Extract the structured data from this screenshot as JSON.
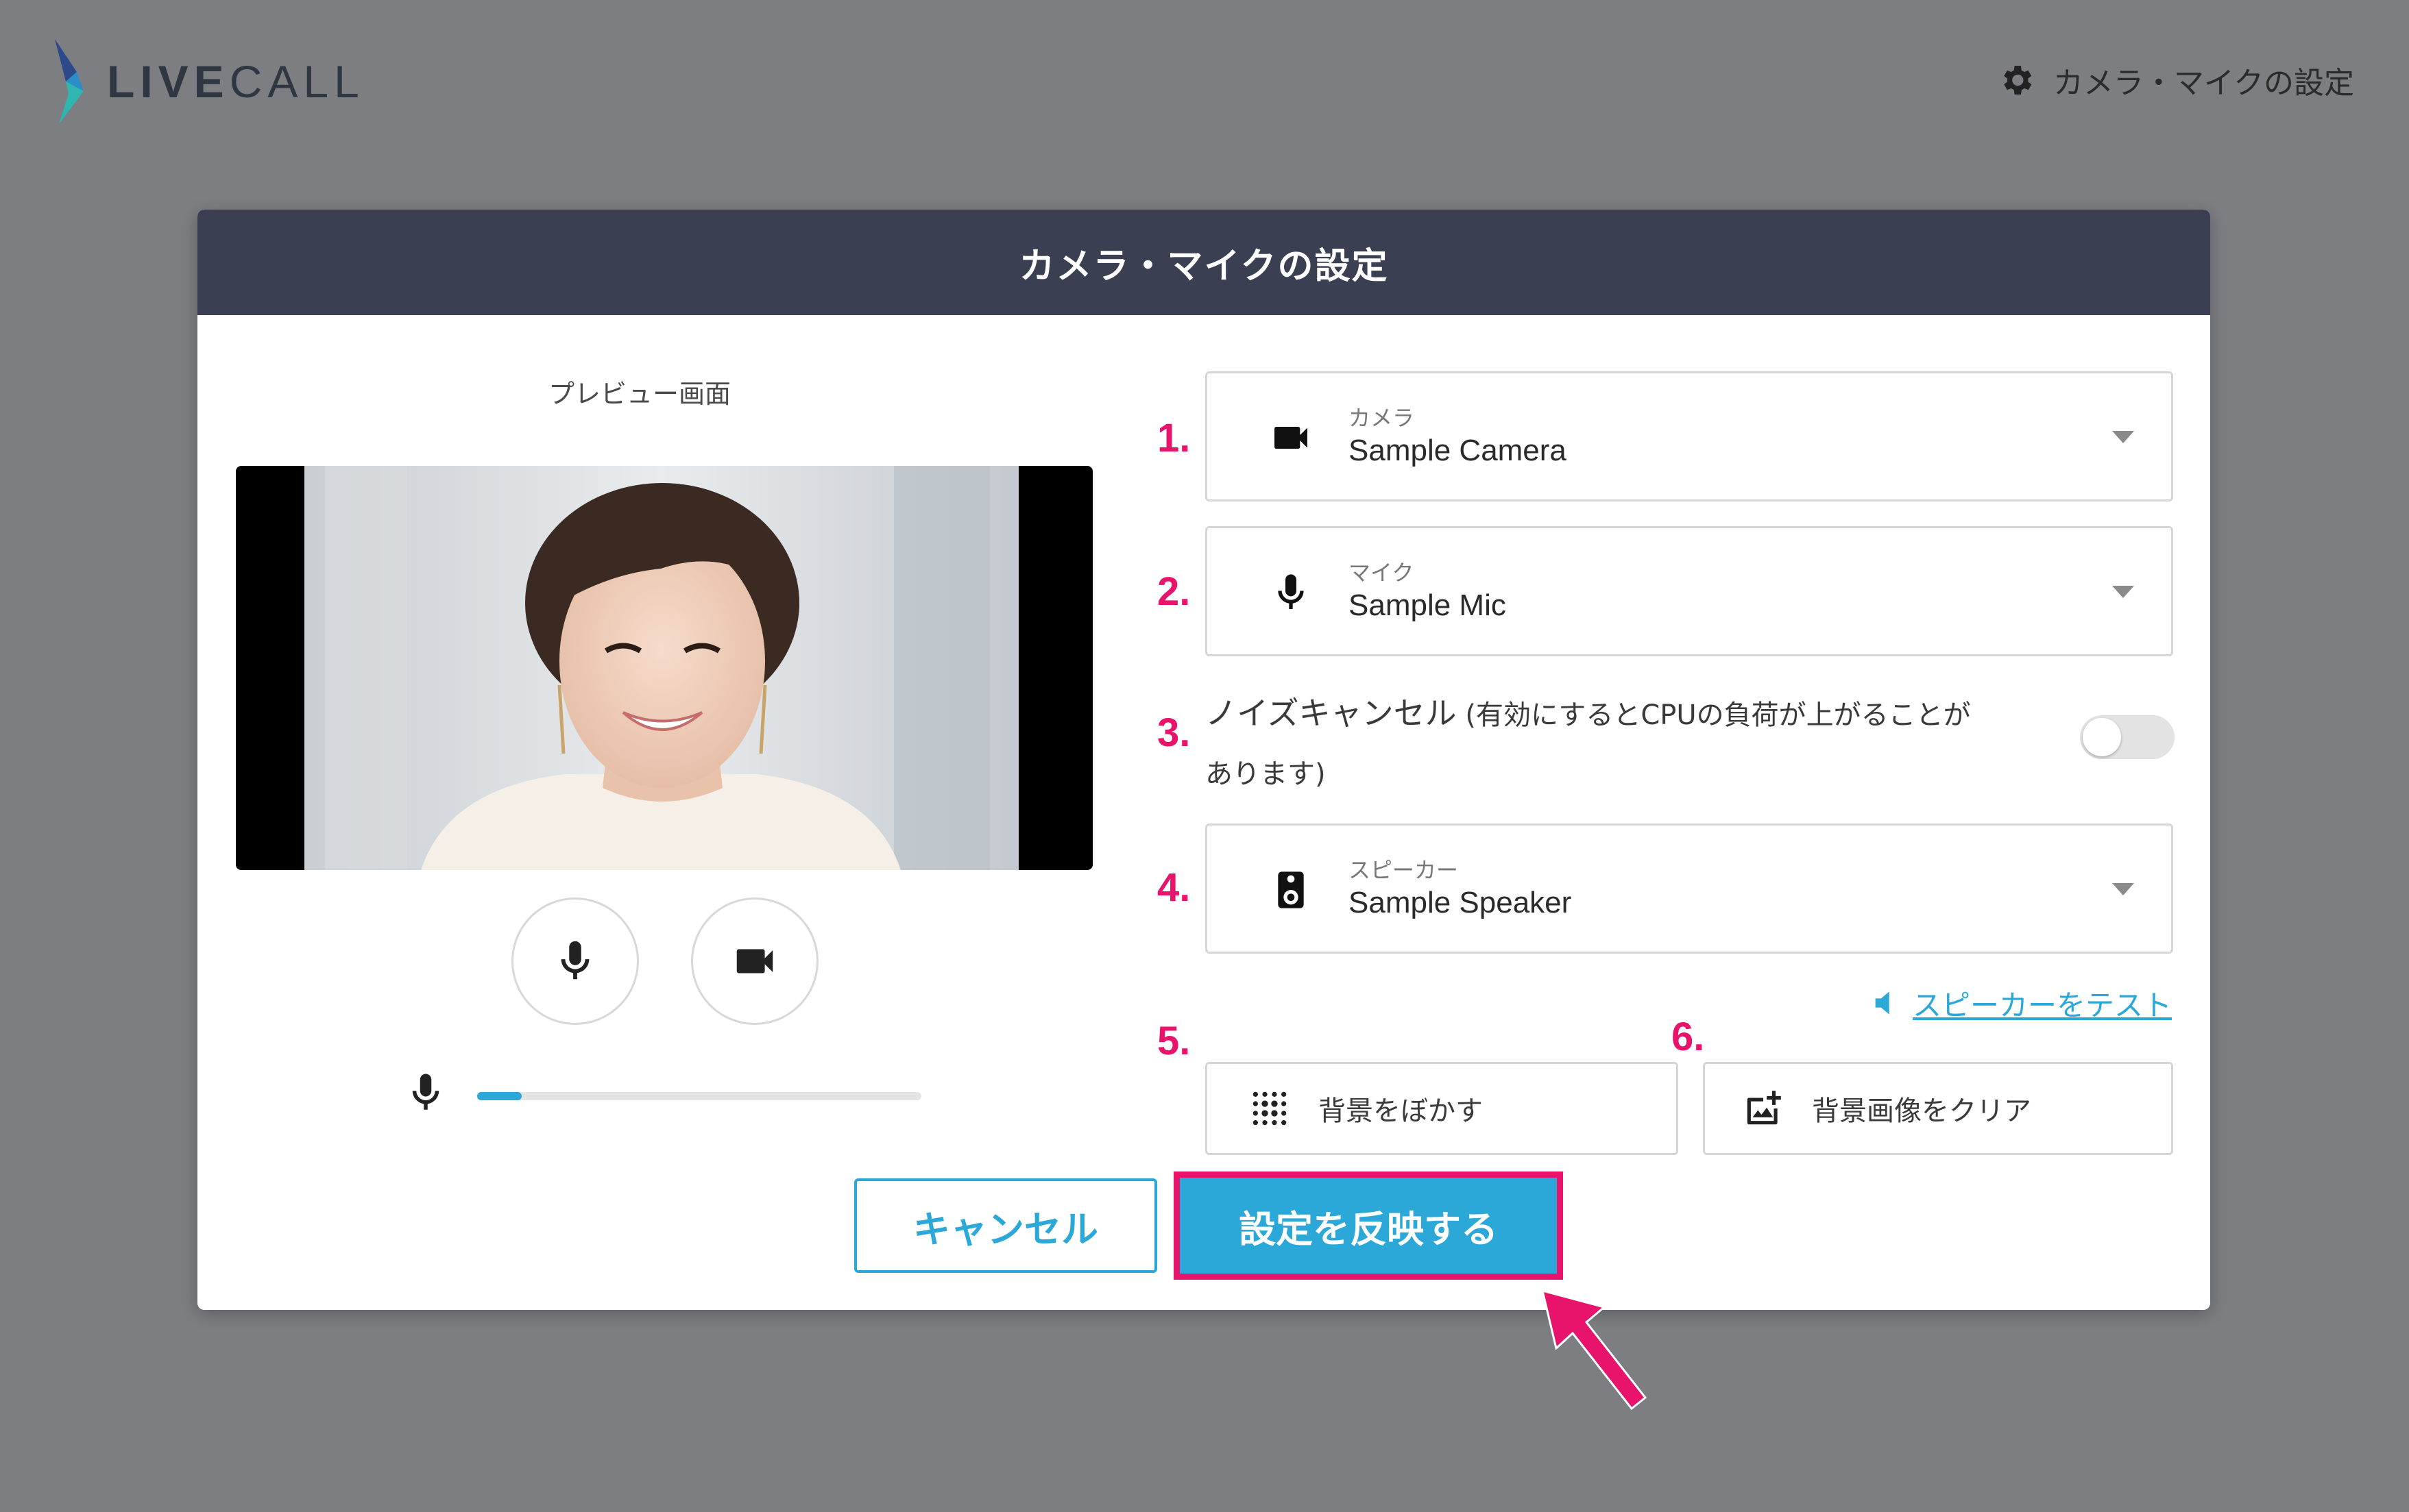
{
  "header": {
    "logo_text_bold": "LIVE",
    "logo_text_light": "CALL",
    "settings_label": "カメラ・マイクの設定",
    "settings_icon": "gear-icon"
  },
  "modal": {
    "title": "カメラ・マイクの設定",
    "preview_label": "プレビュー画面",
    "mic_level_percent": 10
  },
  "markers": [
    "1.",
    "2.",
    "3.",
    "4.",
    "5.",
    "6."
  ],
  "camera": {
    "caption": "カメラ",
    "value": "Sample Camera",
    "icon": "video-camera-icon"
  },
  "mic": {
    "caption": "マイク",
    "value": "Sample Mic",
    "icon": "microphone-icon"
  },
  "noise_cancel": {
    "label_main": "ノイズキャンセル",
    "label_note": " (有効にするとCPUの負荷が上がることがあります)",
    "enabled": false
  },
  "speaker": {
    "caption": "スピーカー",
    "value": "Sample Speaker",
    "icon": "speaker-icon"
  },
  "speaker_test_label": "スピーカーをテスト",
  "background": {
    "blur_label": "背景をぼかす",
    "clear_label": "背景画像をクリア"
  },
  "actions": {
    "cancel_label": "キャンセル",
    "apply_label": "設定を反映する"
  },
  "colors": {
    "accent": "#2ba8d8",
    "highlight": "#e8136a",
    "header_bg": "#3a3f51",
    "page_bg": "#7c7e81"
  }
}
